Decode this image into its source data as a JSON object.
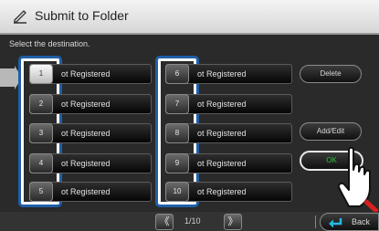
{
  "window": {
    "title": "Submit to Folder"
  },
  "instruction": "Select the destination.",
  "destinations": [
    {
      "number": "1",
      "label": "ot Registered"
    },
    {
      "number": "2",
      "label": "ot Registered"
    },
    {
      "number": "3",
      "label": "ot Registered"
    },
    {
      "number": "4",
      "label": "ot Registered"
    },
    {
      "number": "5",
      "label": "ot Registered"
    },
    {
      "number": "6",
      "label": "ot Registered"
    },
    {
      "number": "7",
      "label": "ot Registered"
    },
    {
      "number": "8",
      "label": "ot Registered"
    },
    {
      "number": "9",
      "label": "ot Registered"
    },
    {
      "number": "10",
      "label": "ot Registered"
    }
  ],
  "actions": {
    "delete": "Delete",
    "add_edit": "Add/Edit",
    "ok": "OK",
    "back": "Back"
  },
  "pagination": {
    "prev": "《",
    "next": "》",
    "indicator": "1/10"
  },
  "colors": {
    "highlight": "#1f5fa8",
    "ok_text": "#2ec23a",
    "back_icon": "#26b8e0"
  },
  "icons": {
    "title": "pencil-edit-icon",
    "pointer": "pointer-arrow-icon",
    "hand": "hand-pointer-icon",
    "back": "back-arrow-icon"
  }
}
